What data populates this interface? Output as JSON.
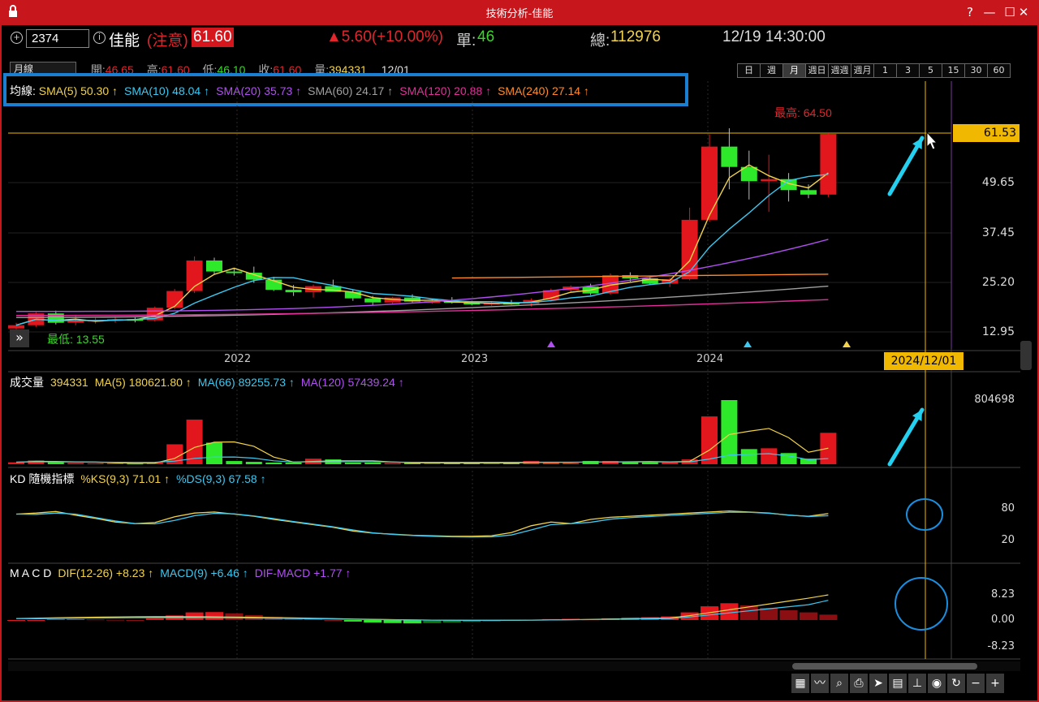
{
  "window": {
    "title": "技術分析-佳能",
    "controls": [
      "?",
      "—",
      "☐",
      "✕"
    ]
  },
  "quote": {
    "code": "2374",
    "name": "佳能",
    "status": "(注意)",
    "price": "61.60",
    "change": "▲5.60(+10.00%)",
    "single_label": "單:",
    "single_value": "46",
    "total_label": "總:",
    "total_value": "112976",
    "datetime": "12/19 14:30:00"
  },
  "ohlc": {
    "period": "月線",
    "open_label": "開:",
    "open": "46.65",
    "high_label": "高:",
    "high": "61.60",
    "low_label": "低:",
    "low": "46.10",
    "close_label": "收:",
    "close": "61.60",
    "vol_label": "量:",
    "vol": "394331",
    "date": "12/01"
  },
  "periods": [
    "日",
    "週",
    "月",
    "週日",
    "週週",
    "週月",
    "1",
    "3",
    "5",
    "15",
    "30",
    "60"
  ],
  "active_period": "月",
  "sma_legend": {
    "prefix": "均線:",
    "items": [
      {
        "text": "SMA(5) 50.30 ↑",
        "color": "#f2d34a"
      },
      {
        "text": "SMA(10) 48.04 ↑",
        "color": "#3cc8f0"
      },
      {
        "text": "SMA(20) 35.73 ↑",
        "color": "#b050f0"
      },
      {
        "text": "SMA(60) 24.17 ↑",
        "color": "#a0a0a0"
      },
      {
        "text": "SMA(120) 20.88 ↑",
        "color": "#e0309a"
      },
      {
        "text": "SMA(240) 27.14 ↑",
        "color": "#ff8a2a"
      }
    ]
  },
  "price_axis": [
    "61.53",
    "49.65",
    "37.45",
    "25.20",
    "12.95"
  ],
  "price_high_label": "最高: 64.50",
  "price_low_label": "最低: 13.55",
  "x_axis": [
    "2022",
    "2023",
    "2024"
  ],
  "cursor_date": "2024/12/01",
  "volume_legend": {
    "items": [
      {
        "text": "成交量",
        "color": "#ffffff"
      },
      {
        "text": "394331",
        "color": "#f2d34a"
      },
      {
        "text": "MA(5) 180621.80 ↑",
        "color": "#f2d34a"
      },
      {
        "text": "MA(66) 89255.73 ↑",
        "color": "#3cc8f0"
      },
      {
        "text": "MA(120) 57439.24 ↑",
        "color": "#b050f0"
      }
    ],
    "axis": "804698"
  },
  "kd_legend": {
    "items": [
      {
        "text": "KD 隨機指標",
        "color": "#ffffff"
      },
      {
        "text": "%KS(9,3) 71.01 ↑",
        "color": "#f2d34a"
      },
      {
        "text": "%DS(9,3) 67.58 ↑",
        "color": "#3cc8f0"
      }
    ],
    "axis": [
      "80",
      "20"
    ]
  },
  "macd_legend": {
    "items": [
      {
        "text": "M A C D",
        "color": "#ffffff"
      },
      {
        "text": "DIF(12-26) +8.23 ↑",
        "color": "#f2d34a"
      },
      {
        "text": "MACD(9) +6.46 ↑",
        "color": "#3cc8f0"
      },
      {
        "text": "DIF-MACD +1.77 ↑",
        "color": "#b050f0"
      }
    ],
    "axis": [
      "8.23",
      "0.00",
      "-8.23"
    ]
  },
  "toolbar": [
    "grid-icon",
    "trend-icon",
    "find-icon",
    "print-icon",
    "pointer-icon",
    "table-icon",
    "measure-icon",
    "eye-icon",
    "refresh-icon",
    "zoom-out-icon",
    "zoom-in-icon"
  ],
  "chart_data": {
    "type": "candlestick",
    "period": "monthly",
    "candles": [
      {
        "o": 13.8,
        "h": 15.2,
        "l": 13.55,
        "c": 14.6
      },
      {
        "o": 14.6,
        "h": 17.8,
        "l": 14.2,
        "c": 17.5
      },
      {
        "o": 17.5,
        "h": 18.2,
        "l": 14.8,
        "c": 15.2
      },
      {
        "o": 15.2,
        "h": 17.2,
        "l": 14.6,
        "c": 15.6
      },
      {
        "o": 15.6,
        "h": 16.4,
        "l": 15.0,
        "c": 15.9
      },
      {
        "o": 15.9,
        "h": 16.8,
        "l": 15.2,
        "c": 16.1
      },
      {
        "o": 16.1,
        "h": 16.5,
        "l": 15.3,
        "c": 15.8
      },
      {
        "o": 15.8,
        "h": 19.2,
        "l": 15.5,
        "c": 18.9
      },
      {
        "o": 18.9,
        "h": 23.5,
        "l": 18.5,
        "c": 23.0
      },
      {
        "o": 23.0,
        "h": 31.5,
        "l": 22.5,
        "c": 30.5
      },
      {
        "o": 30.5,
        "h": 31.2,
        "l": 27.0,
        "c": 27.8
      },
      {
        "o": 27.8,
        "h": 28.6,
        "l": 26.8,
        "c": 27.5
      },
      {
        "o": 27.5,
        "h": 29.0,
        "l": 25.0,
        "c": 25.8
      },
      {
        "o": 25.8,
        "h": 26.5,
        "l": 23.0,
        "c": 23.3
      },
      {
        "o": 23.3,
        "h": 24.5,
        "l": 21.8,
        "c": 22.7
      },
      {
        "o": 22.7,
        "h": 24.6,
        "l": 21.4,
        "c": 24.2
      },
      {
        "o": 24.2,
        "h": 25.8,
        "l": 23.0,
        "c": 22.8
      },
      {
        "o": 22.8,
        "h": 23.4,
        "l": 20.6,
        "c": 21.2
      },
      {
        "o": 21.2,
        "h": 21.8,
        "l": 19.6,
        "c": 20.2
      },
      {
        "o": 20.2,
        "h": 21.6,
        "l": 19.7,
        "c": 21.4
      },
      {
        "o": 21.4,
        "h": 22.2,
        "l": 20.2,
        "c": 20.4
      },
      {
        "o": 20.4,
        "h": 21.0,
        "l": 19.9,
        "c": 20.5
      },
      {
        "o": 20.5,
        "h": 21.5,
        "l": 19.9,
        "c": 20.1
      },
      {
        "o": 20.1,
        "h": 20.6,
        "l": 19.5,
        "c": 19.8
      },
      {
        "o": 19.8,
        "h": 20.4,
        "l": 19.4,
        "c": 20.1
      },
      {
        "o": 20.1,
        "h": 20.8,
        "l": 19.6,
        "c": 19.9
      },
      {
        "o": 19.9,
        "h": 21.2,
        "l": 19.2,
        "c": 20.8
      },
      {
        "o": 20.8,
        "h": 23.6,
        "l": 20.4,
        "c": 23.2
      },
      {
        "o": 23.2,
        "h": 24.4,
        "l": 22.7,
        "c": 24.1
      },
      {
        "o": 24.1,
        "h": 24.8,
        "l": 22.0,
        "c": 22.4
      },
      {
        "o": 22.4,
        "h": 27.3,
        "l": 22.1,
        "c": 26.9
      },
      {
        "o": 26.9,
        "h": 27.6,
        "l": 25.3,
        "c": 26.1
      },
      {
        "o": 26.1,
        "h": 26.7,
        "l": 24.5,
        "c": 24.8
      },
      {
        "o": 24.8,
        "h": 26.3,
        "l": 24.0,
        "c": 25.9
      },
      {
        "o": 25.9,
        "h": 43.5,
        "l": 25.6,
        "c": 40.5
      },
      {
        "o": 40.5,
        "h": 61.5,
        "l": 40.0,
        "c": 58.5
      },
      {
        "o": 58.5,
        "h": 63.0,
        "l": 48.0,
        "c": 53.5
      },
      {
        "o": 53.5,
        "h": 57.5,
        "l": 45.5,
        "c": 50.0
      },
      {
        "o": 50.0,
        "h": 56.5,
        "l": 42.5,
        "c": 50.5
      },
      {
        "o": 50.5,
        "h": 52.0,
        "l": 45.0,
        "c": 47.8
      },
      {
        "o": 47.8,
        "h": 49.2,
        "l": 45.8,
        "c": 46.7
      },
      {
        "o": 46.7,
        "h": 61.8,
        "l": 46.1,
        "c": 61.6
      }
    ],
    "highest": 64.5,
    "lowest": 13.55,
    "sma_last": {
      "SMA(5)": 50.3,
      "SMA(10)": 48.04,
      "SMA(20)": 35.73,
      "SMA(60)": 24.17,
      "SMA(120)": 20.88,
      "SMA(240)": 27.14
    },
    "volume_max": 804698,
    "volume_last": 394331,
    "kd": {
      "K": 71.01,
      "D": 67.58
    },
    "macd": {
      "DIF": 8.23,
      "MACD": 6.46,
      "OSC": 1.77
    }
  }
}
